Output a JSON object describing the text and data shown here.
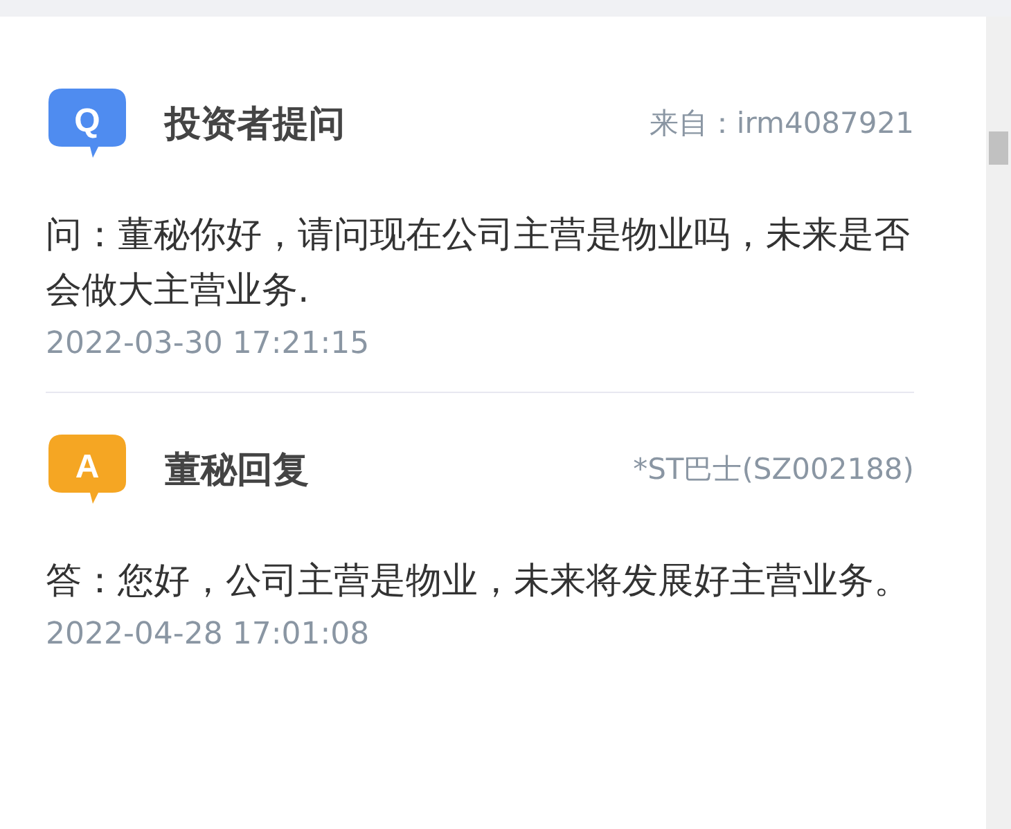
{
  "entries": [
    {
      "kind": "question",
      "badge": "Q",
      "title": "投资者提问",
      "source": "来自：irm4087921",
      "body": "问：董秘你好，请问现在公司主营是物业吗，未来是否会做大主营业务.",
      "time": "2022-03-30 17:21:15"
    },
    {
      "kind": "answer",
      "badge": "A",
      "title": "董秘回复",
      "source": "*ST巴士(SZ002188)",
      "body": "答：您好，公司主营是物业，未来将发展好主营业务。",
      "time": "2022-04-28 17:01:08"
    }
  ]
}
